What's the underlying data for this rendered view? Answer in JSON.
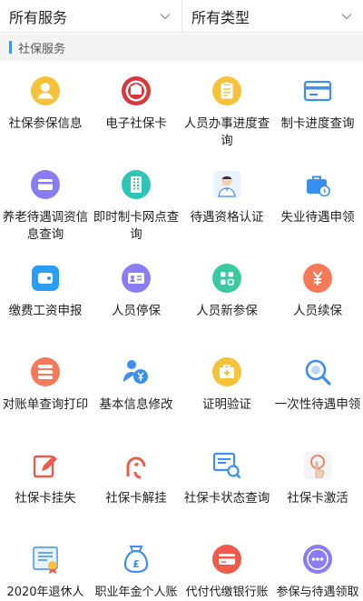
{
  "filters": {
    "services": "所有服务",
    "types": "所有类型"
  },
  "section": {
    "title": "社保服务",
    "accent": "#3b8ff0"
  },
  "items": [
    {
      "label": "社保参保信息",
      "icon": "user-badge-icon",
      "color": "#f5c33b"
    },
    {
      "label": "电子社保卡",
      "icon": "social-security-emblem-icon",
      "color": "#d9363e"
    },
    {
      "label": "人员办事进度查询",
      "icon": "clipboard-progress-icon",
      "color": "#f5c33b"
    },
    {
      "label": "制卡进度查询",
      "icon": "card-icon",
      "color": "#3b8ff0"
    },
    {
      "label": "养老待遇调资信息查询",
      "icon": "wallet-card-icon",
      "color": "#8a7cf2"
    },
    {
      "label": "即时制卡网点查询",
      "icon": "building-icon",
      "color": "#2ec4b6"
    },
    {
      "label": "待遇资格认证",
      "icon": "person-portrait-icon",
      "color": "#3b8ff0"
    },
    {
      "label": "失业待遇申领",
      "icon": "briefcase-icon",
      "color": "#3b8ff0"
    },
    {
      "label": "缴费工资申报",
      "icon": "wallet-icon",
      "color": "#2a9df4"
    },
    {
      "label": "人员停保",
      "icon": "id-card-icon",
      "color": "#8a7cf2"
    },
    {
      "label": "人员新参保",
      "icon": "apps-grid-icon",
      "color": "#3cc8a0"
    },
    {
      "label": "人员续保",
      "icon": "yuan-coin-icon",
      "color": "#f47a5a"
    },
    {
      "label": "对账单查询打印",
      "icon": "list-document-icon",
      "color": "#f47a5a"
    },
    {
      "label": "基本信息修改",
      "icon": "person-yuan-icon",
      "color": "#3b8ff0"
    },
    {
      "label": "证明验证",
      "icon": "medical-kit-icon",
      "color": "#f5c33b"
    },
    {
      "label": "一次性待遇申领",
      "icon": "search-magnifier-icon",
      "color": "#3b8ff0"
    },
    {
      "label": "社保卡挂失",
      "icon": "edit-icon",
      "color": "#f05a4a"
    },
    {
      "label": "社保卡解挂",
      "icon": "unlock-hand-icon",
      "color": "#f05a4a"
    },
    {
      "label": "社保卡状态查询",
      "icon": "card-search-icon",
      "color": "#3b8ff0"
    },
    {
      "label": "社保卡激活",
      "icon": "touch-activate-icon",
      "color": "#f47a5a"
    },
    {
      "label": "2020年退休人",
      "icon": "certificate-icon",
      "color": "#3b8ff0"
    },
    {
      "label": "职业年金个人账",
      "icon": "money-bag-icon",
      "color": "#3b8ff0"
    },
    {
      "label": "代付代缴银行账",
      "icon": "bank-card-icon",
      "color": "#f05a4a"
    },
    {
      "label": "参保与待遇领取",
      "icon": "more-dots-icon",
      "color": "#8a7cf2"
    }
  ]
}
